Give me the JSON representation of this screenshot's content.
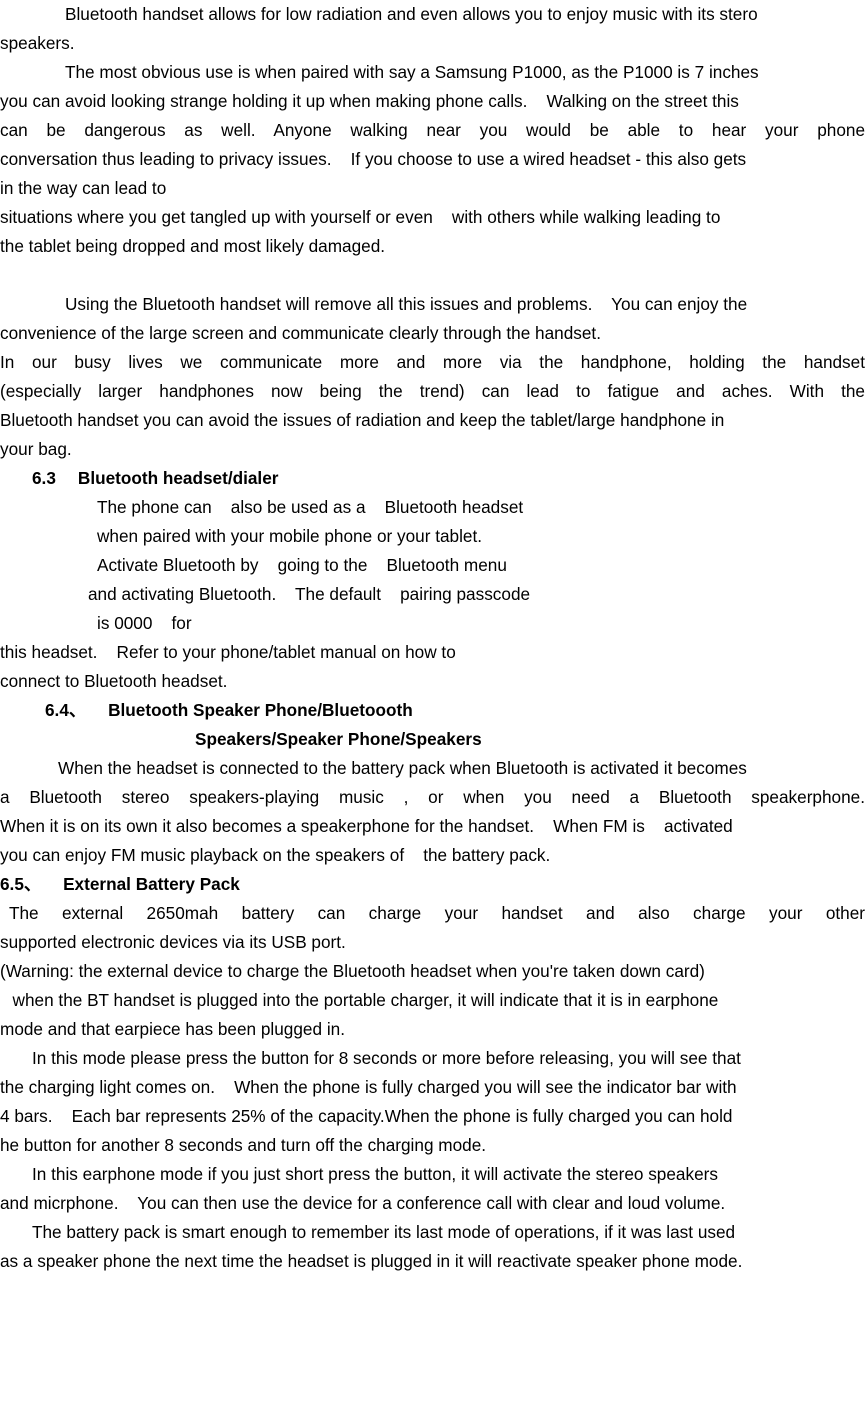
{
  "document": {
    "type": "product-manual-page",
    "text_color": "#000000",
    "background_color": "#ffffff",
    "lines": [
      {
        "id": "l01",
        "text": "Bluetooth handset allows for low radiation and even allows you to enjoy music with its stero",
        "style": "indent-first",
        "justified": false
      },
      {
        "id": "l02",
        "text": "speakers.",
        "style": "flush",
        "justified": false
      },
      {
        "id": "l03",
        "text": "The most obvious use is when paired with say a Samsung P1000, as the P1000 is 7 inches",
        "style": "indent-first",
        "justified": false
      },
      {
        "id": "l04",
        "text": "you can avoid looking strange holding it up when making phone calls.    Walking on the street this",
        "style": "flush",
        "justified": false
      },
      {
        "id": "l05",
        "text": "can be dangerous as well.   Anyone walking near you would be able to hear your phone",
        "style": "flush",
        "justified": true
      },
      {
        "id": "l06",
        "text": "conversation thus leading to privacy issues.    If you choose to use a wired headset - this also gets",
        "style": "flush",
        "justified": false
      },
      {
        "id": "l07",
        "text": "in the way can lead to",
        "style": "flush",
        "justified": false
      },
      {
        "id": "l08",
        "text": "situations where you get tangled up with yourself or even    with others while walking leading to",
        "style": "flush",
        "justified": false
      },
      {
        "id": "l09",
        "text": "the tablet being dropped and most likely damaged.",
        "style": "flush",
        "justified": false
      },
      {
        "id": "l10",
        "text": "",
        "style": "blank",
        "justified": false
      },
      {
        "id": "l11",
        "text": "Using the Bluetooth handset will remove all this issues and problems.    You can enjoy the",
        "style": "indent-first",
        "justified": false
      },
      {
        "id": "l12",
        "text": "convenience of the large screen and communicate clearly through the handset.",
        "style": "flush",
        "justified": false
      },
      {
        "id": "l13",
        "text": "In our busy lives we communicate more and more via the handphone,   holding the handset",
        "style": "flush",
        "justified": true
      },
      {
        "id": "l14",
        "text": "(especially larger handphones now being the trend) can lead to fatigue and aches.   With the",
        "style": "flush",
        "justified": true
      },
      {
        "id": "l15",
        "text": "Bluetooth handset you can avoid the issues of radiation and keep the tablet/large handphone in",
        "style": "flush",
        "justified": false
      },
      {
        "id": "l16",
        "text": "your bag.",
        "style": "flush",
        "justified": false
      }
    ],
    "section_6_3": {
      "number": "6.3",
      "title": "Bluetooth headset/dialer",
      "body_lines": [
        "The phone can    also be used as a    Bluetooth headset",
        "when paired with your mobile phone or your tablet.",
        "Activate Bluetooth by    going to the    Bluetooth menu",
        "and activating Bluetooth.    The default    pairing passcode",
        "is 0000    for"
      ],
      "continuation_lines": [
        "this headset.    Refer to your phone/tablet manual on how to",
        "connect to Bluetooth headset."
      ]
    },
    "section_6_4": {
      "number": "6.4、",
      "title_line_1": "Bluetooth Speaker Phone/Bluetoooth",
      "title_line_2": "Speakers/Speaker Phone/Speakers",
      "body_lines": [
        "When the headset is connected to the battery pack when Bluetooth is activated it becomes",
        "a Bluetooth stereo speakers-playing music , or when you need a   Bluetooth   speakerphone.",
        "When it is on its own it also becomes a speakerphone for the handset.    When FM is    activated",
        "you can enjoy FM music playback on the speakers of    the battery pack."
      ]
    },
    "section_6_5": {
      "number": "6.5、",
      "title": "External Battery Pack",
      "body_lines": [
        "The external 2650mah battery can charge your handset and     also   charge your other",
        "supported electronic devices via its USB port.",
        "(Warning: the external device to charge the Bluetooth headset when you're taken down card)",
        "  when the BT handset is plugged into the portable charger, it will indicate that it is in earphone",
        "mode and that earpiece has been plugged in.",
        "In this mode please press the button for 8 seconds or more before releasing, you will see that",
        "the charging light comes on.    When the phone is fully charged you will see the indicator bar with",
        "4 bars.    Each bar represents 25% of the capacity.When the phone is fully charged you can hold",
        "he button for another 8 seconds and turn off the charging mode.",
        "In this earphone mode if you just short press the button, it will activate the stereo speakers",
        "and micrphone.    You can then use the device for a conference call with clear and loud volume.",
        "The battery pack is smart enough to remember its last mode of operations, if it was last used",
        "as a speaker phone the next time the headset is plugged in it will reactivate speaker phone mode."
      ]
    }
  }
}
